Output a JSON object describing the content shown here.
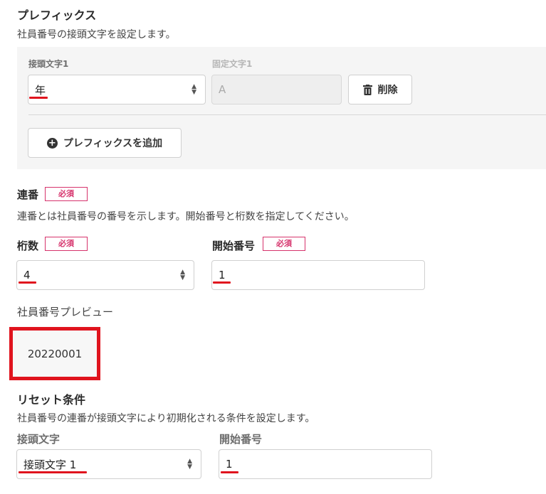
{
  "prefix": {
    "title": "プレフィックス",
    "description": "社員番号の接頭文字を設定します。",
    "prefix_label": "接頭文字1",
    "fixed_label": "固定文字1",
    "prefix_value": "年",
    "fixed_placeholder": "A",
    "delete_label": "削除",
    "add_label": "プレフィックスを追加"
  },
  "serial": {
    "title": "連番",
    "required": "必須",
    "description": "連番とは社員番号の番号を示します。開始番号と桁数を指定してください。",
    "digits_label": "桁数",
    "digits_value": "4",
    "start_label": "開始番号",
    "start_value": "1"
  },
  "preview": {
    "label": "社員番号プレビュー",
    "value": "20220001"
  },
  "reset": {
    "title": "リセット条件",
    "description": "社員番号の連番が接頭文字により初期化される条件を設定します。",
    "prefix_label": "接頭文字",
    "prefix_value": "接頭文字 1",
    "start_label": "開始番号",
    "start_value": "1"
  },
  "colors": {
    "required_badge": "#d6336c",
    "highlight_red": "#e0141e",
    "panel_bg": "#f5f5f5"
  },
  "icons": {
    "trash": "trash-icon",
    "plus": "plus-circle-icon",
    "select_arrows": "sort-arrows-icon"
  }
}
